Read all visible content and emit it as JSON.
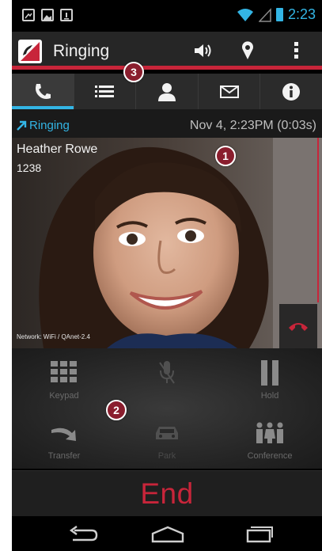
{
  "statusbar": {
    "time": "2:23",
    "icons": [
      "missed-call-icon",
      "image-notification-icon",
      "download-icon",
      "wifi-icon",
      "signal-icon",
      "battery-icon"
    ]
  },
  "actionbar": {
    "title": "Ringing",
    "icons": [
      "app-logo-icon",
      "speaker-icon",
      "location-pin-icon",
      "overflow-menu-icon"
    ]
  },
  "tabs": [
    {
      "icon": "phone-icon",
      "active": true
    },
    {
      "icon": "list-icon",
      "active": false
    },
    {
      "icon": "contact-icon",
      "active": false
    },
    {
      "icon": "mail-icon",
      "active": false
    },
    {
      "icon": "info-icon",
      "active": false
    }
  ],
  "call": {
    "state": "Ringing",
    "time": "Nov 4, 2:23PM (0:03s)",
    "caller_name": "Heather Rowe",
    "caller_number": "1238",
    "network": "Network: WiFi / QAnet-2.4"
  },
  "controls": [
    {
      "label": "Keypad",
      "icon": "keypad-icon",
      "enabled": true
    },
    {
      "label": "",
      "icon": "mute-microphone-icon",
      "enabled": false
    },
    {
      "label": "Hold",
      "icon": "pause-icon",
      "enabled": true
    },
    {
      "label": "Transfer",
      "icon": "transfer-arrow-icon",
      "enabled": true
    },
    {
      "label": "Park",
      "icon": "car-icon",
      "enabled": false
    },
    {
      "label": "Conference",
      "icon": "conference-people-icon",
      "enabled": true
    }
  ],
  "end_label": "End",
  "navbar": {
    "icons": [
      "back-icon",
      "home-icon",
      "recents-icon"
    ]
  },
  "callouts": [
    "1",
    "2",
    "3"
  ],
  "colors": {
    "accent_red": "#c8253a",
    "accent_blue": "#33b5e5",
    "callout": "#8a1e2e"
  }
}
